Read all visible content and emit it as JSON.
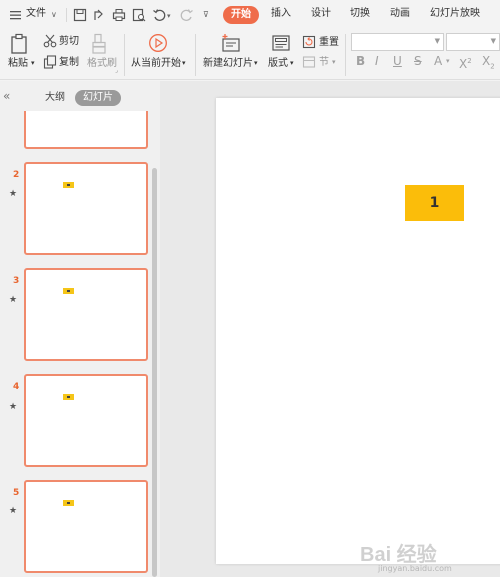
{
  "menu": {
    "file_label": "文件",
    "tabs": [
      "开始",
      "插入",
      "设计",
      "切换",
      "动画",
      "幻灯片放映"
    ]
  },
  "toolbar": {
    "paste": "粘贴",
    "cut": "剪切",
    "copy": "复制",
    "format_painter": "格式刷",
    "play_from_current": "从当前开始",
    "new_slide": "新建幻灯片",
    "layout": "版式",
    "reset": "重置",
    "section": "节"
  },
  "left_panel": {
    "tab_outline": "大纲",
    "tab_slides": "幻灯片",
    "slides": [
      {
        "num": "2",
        "star": "★"
      },
      {
        "num": "3",
        "star": "★"
      },
      {
        "num": "4",
        "star": "★"
      },
      {
        "num": "5",
        "star": "★"
      }
    ]
  },
  "slide": {
    "box_text": "1",
    "box_color": "#fbbd0a"
  },
  "colors": {
    "accent": "#ef6c4a",
    "thumb_border": "#f08a6c",
    "slide_number": "#e8652f"
  },
  "watermark": {
    "logo": "Bai 经验",
    "url": "jingyan.baidu.com"
  }
}
